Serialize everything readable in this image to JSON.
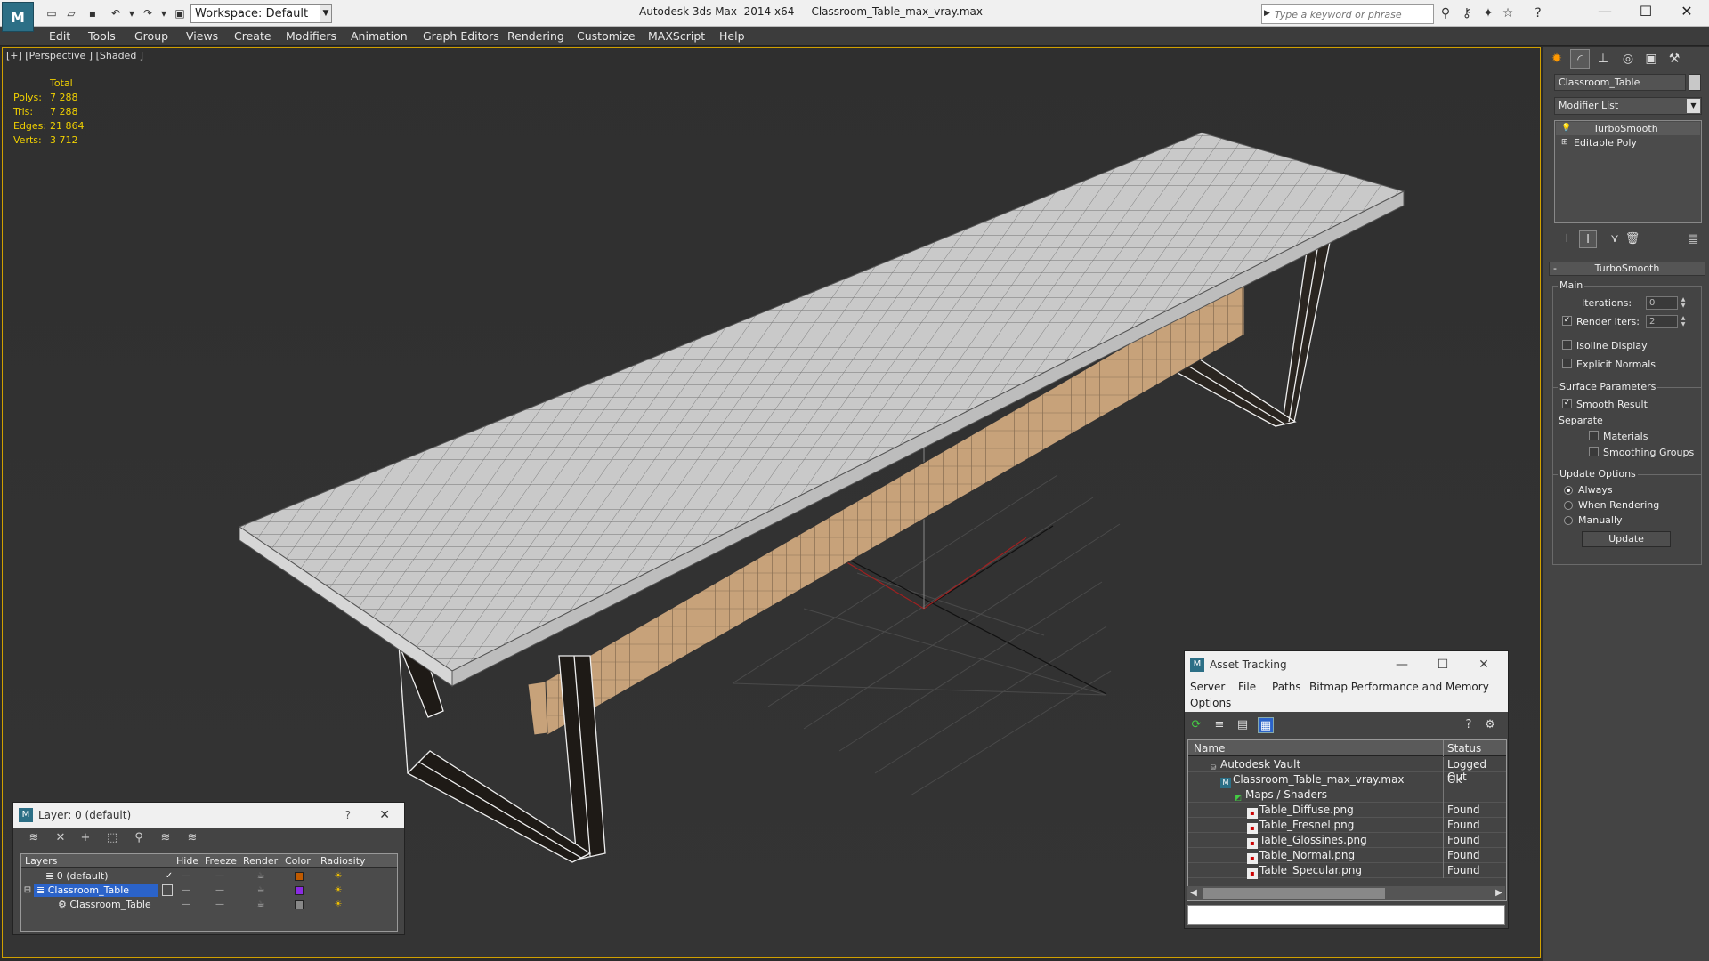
{
  "titlebar": {
    "workspace_label": "Workspace: Default",
    "app_name": "Autodesk 3ds Max  2014 x64",
    "file_name": "Classroom_Table_max_vray.max",
    "search_placeholder": "Type a keyword or phrase"
  },
  "menu": [
    "Edit",
    "Tools",
    "Group",
    "Views",
    "Create",
    "Modifiers",
    "Animation",
    "Graph Editors",
    "Rendering",
    "Customize",
    "MAXScript",
    "Help"
  ],
  "viewport": {
    "label": "[+] [Perspective ] [Shaded ]",
    "stats": {
      "header": "Total",
      "rows": [
        {
          "label": "Polys:",
          "value": "7 288"
        },
        {
          "label": "Tris:",
          "value": "7 288"
        },
        {
          "label": "Edges:",
          "value": "21 864"
        },
        {
          "label": "Verts:",
          "value": "3 712"
        }
      ]
    }
  },
  "layer_dialog": {
    "title": "Layer: 0 (default)",
    "help": "?",
    "columns": [
      "Layers",
      "Hide",
      "Freeze",
      "Render",
      "Color",
      "Radiosity"
    ],
    "rows": [
      {
        "name": "0 (default)",
        "color": "#c05a00",
        "selected": false,
        "active": true
      },
      {
        "name": "Classroom_Table",
        "color": "#8a2be2",
        "selected": true,
        "active": false
      },
      {
        "name": "Classroom_Table",
        "color": "#888888",
        "selected": false,
        "active": false
      }
    ]
  },
  "asset_dialog": {
    "title": "Asset Tracking",
    "menu": [
      "Server",
      "File",
      "Paths",
      "Bitmap Performance and Memory",
      "Options"
    ],
    "columns": [
      "Name",
      "Status"
    ],
    "rows": [
      {
        "name": "Autodesk Vault",
        "status": "Logged Out",
        "icon": "vault-icon"
      },
      {
        "name": "Classroom_Table_max_vray.max",
        "status": "Ok",
        "icon": "max-file-icon"
      },
      {
        "name": "Maps / Shaders",
        "status": "",
        "icon": "maps-folder-icon"
      },
      {
        "name": "Table_Diffuse.png",
        "status": "Found",
        "icon": "png-file-icon"
      },
      {
        "name": "Table_Fresnel.png",
        "status": "Found",
        "icon": "png-file-icon"
      },
      {
        "name": "Table_Glossines.png",
        "status": "Found",
        "icon": "png-file-icon"
      },
      {
        "name": "Table_Normal.png",
        "status": "Found",
        "icon": "png-file-icon"
      },
      {
        "name": "Table_Specular.png",
        "status": "Found",
        "icon": "png-file-icon"
      }
    ]
  },
  "command_panel": {
    "object_name": "Classroom_Table",
    "modifier_list": "Modifier List",
    "stack": [
      "TurboSmooth",
      "Editable Poly"
    ],
    "rollout_title": "TurboSmooth",
    "main_group": "Main",
    "iterations_label": "Iterations:",
    "iterations_value": "0",
    "render_iters_label": "Render Iters:",
    "render_iters_value": "2",
    "render_iters_checked": true,
    "isoline_label": "Isoline Display",
    "explicit_normals_label": "Explicit Normals",
    "surface_group": "Surface Parameters",
    "smooth_result_label": "Smooth Result",
    "separate_label": "Separate",
    "materials_label": "Materials",
    "smoothing_groups_label": "Smoothing Groups",
    "update_group": "Update Options",
    "update_always": "Always",
    "update_rendering": "When Rendering",
    "update_manually": "Manually",
    "update_button": "Update"
  }
}
